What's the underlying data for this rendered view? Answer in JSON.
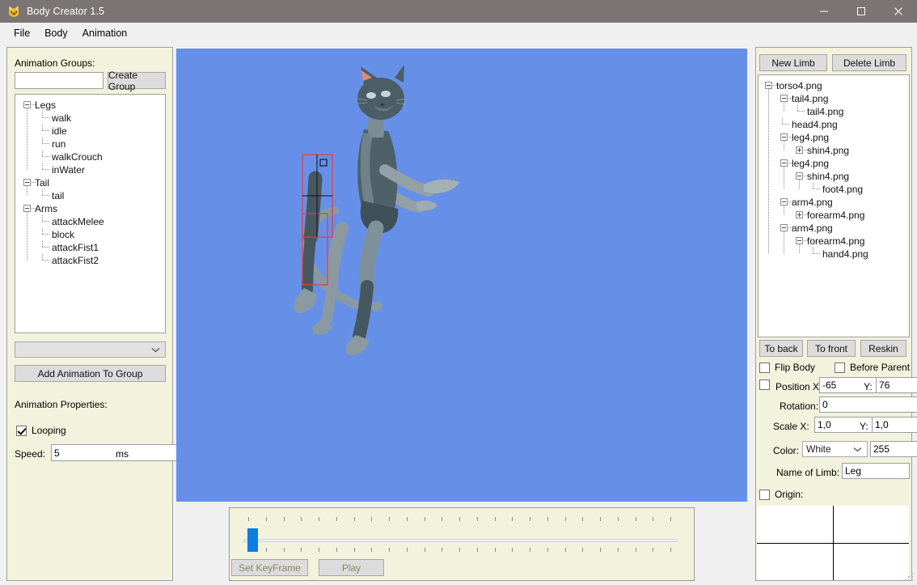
{
  "window": {
    "title": "Body Creator 1.5",
    "icon": "cat-icon",
    "controls": {
      "minimize": "minimize-icon",
      "maximize": "maximize-icon",
      "close": "close-icon"
    }
  },
  "menubar": {
    "items": [
      "File",
      "Body",
      "Animation"
    ]
  },
  "left_panel": {
    "groups_label": "Animation Groups:",
    "group_name_value": "",
    "group_name_placeholder": "",
    "create_group_label": "Create Group",
    "tree": [
      {
        "label": "Legs",
        "depth": 0,
        "expander": "minus"
      },
      {
        "label": "walk",
        "depth": 1,
        "expander": "none"
      },
      {
        "label": "idle",
        "depth": 1,
        "expander": "none"
      },
      {
        "label": "run",
        "depth": 1,
        "expander": "none"
      },
      {
        "label": "walkCrouch",
        "depth": 1,
        "expander": "none"
      },
      {
        "label": "inWater",
        "depth": 1,
        "expander": "none"
      },
      {
        "label": "Tail",
        "depth": 0,
        "expander": "minus"
      },
      {
        "label": "tail",
        "depth": 1,
        "expander": "none"
      },
      {
        "label": "Arms",
        "depth": 0,
        "expander": "minus"
      },
      {
        "label": "attackMelee",
        "depth": 1,
        "expander": "none"
      },
      {
        "label": "block",
        "depth": 1,
        "expander": "none"
      },
      {
        "label": "attackFist1",
        "depth": 1,
        "expander": "none"
      },
      {
        "label": "attackFist2",
        "depth": 1,
        "expander": "none"
      }
    ],
    "animation_select_value": "",
    "add_animation_label": "Add Animation To Group",
    "properties_label": "Animation Properties:",
    "looping_label": "Looping",
    "looping_checked": true,
    "speed_label": "Speed:",
    "speed_value": "5",
    "speed_unit": "ms"
  },
  "right_panel": {
    "new_limb_label": "New Limb",
    "delete_limb_label": "Delete Limb",
    "tree": [
      {
        "label": "torso4.png",
        "depth": 0,
        "expander": "minus"
      },
      {
        "label": "tail4.png",
        "depth": 1,
        "expander": "minus"
      },
      {
        "label": "tail4.png",
        "depth": 2,
        "expander": "none"
      },
      {
        "label": "head4.png",
        "depth": 1,
        "expander": "none"
      },
      {
        "label": "leg4.png",
        "depth": 1,
        "expander": "minus"
      },
      {
        "label": "shin4.png",
        "depth": 2,
        "expander": "plus"
      },
      {
        "label": "leg4.png",
        "depth": 1,
        "expander": "minus"
      },
      {
        "label": "shin4.png",
        "depth": 2,
        "expander": "minus"
      },
      {
        "label": "foot4.png",
        "depth": 3,
        "expander": "none"
      },
      {
        "label": "arm4.png",
        "depth": 1,
        "expander": "minus"
      },
      {
        "label": "forearm4.png",
        "depth": 2,
        "expander": "plus"
      },
      {
        "label": "arm4.png",
        "depth": 1,
        "expander": "minus"
      },
      {
        "label": "forearm4.png",
        "depth": 2,
        "expander": "minus"
      },
      {
        "label": "hand4.png",
        "depth": 3,
        "expander": "none"
      }
    ],
    "to_back_label": "To back",
    "to_front_label": "To front",
    "reskin_label": "Reskin",
    "flip_body_label": "Flip Body",
    "flip_body_checked": false,
    "before_parent_label": "Before Parent",
    "before_parent_checked": false,
    "position_checkbox_checked": false,
    "position_label": "Position X:",
    "position_x_value": "-65",
    "position_y_label": "Y:",
    "position_y_value": "76",
    "rotation_label": "Rotation:",
    "rotation_value": "0",
    "scale_label": "Scale X:",
    "scale_x_value": "1,0",
    "scale_y_label": "Y:",
    "scale_y_value": "1,0",
    "color_label": "Color:",
    "color_value": "White",
    "alpha_value": "255",
    "name_of_limb_label": "Name of Limb:",
    "name_of_limb_value": "Leg",
    "origin_label": "Origin:",
    "origin_checked": false
  },
  "timeline": {
    "slider_position_percent": 1,
    "tick_count": 25,
    "set_keyframe_label": "Set KeyFrame",
    "play_label": "Play",
    "buttons_disabled": true
  },
  "canvas": {
    "background_color": "#6690e8",
    "character": "cat-skeleton",
    "selection_color": "#e83b3b",
    "selected_limb": "Leg"
  },
  "colors": {
    "panel_bg": "#f3f2dd",
    "titlebar": "#7a7574",
    "canvas_blue": "#6690e8",
    "accent_blue": "#0a7fe0",
    "disabled_text": "#8b8558"
  }
}
